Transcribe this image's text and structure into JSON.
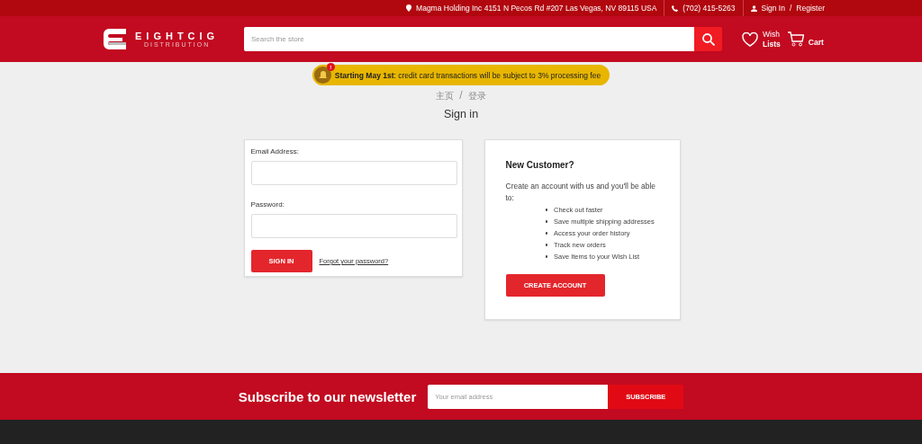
{
  "top_bar": {
    "address": "Magma Holding Inc 4151 N Pecos Rd #207 Las Vegas, NV 89115 USA",
    "phone": "(702) 415-5263",
    "sign_in": "Sign In",
    "separator": "/",
    "register": "Register"
  },
  "header": {
    "logo": {
      "name": "EIGHTCIG",
      "tagline": "DISTRIBUTION"
    },
    "search": {
      "placeholder": "Search the store"
    },
    "wishlist": {
      "line1": "Wish",
      "line2": "Lists"
    },
    "cart": "Cart"
  },
  "notice": {
    "text": "**Starting May 1st**: credit card transactions will be subject to 3% processing fee",
    "badge": "!"
  },
  "breadcrumbs": [
    {
      "label": "主页"
    },
    {
      "label": "登录"
    }
  ],
  "breadcrumb_separator": "/",
  "page_title": "Sign in",
  "login_form": {
    "email_label": "Email Address:",
    "password_label": "Password:",
    "submit": "SIGN IN",
    "forgot": "Forgot your password?"
  },
  "new_customer": {
    "title": "New Customer?",
    "intro": "Create an account with us and you'll be able to:",
    "benefits": [
      "Check out faster",
      "Save multiple shipping addresses",
      "Access your order history",
      "Track new orders",
      "Save Items to your Wish List"
    ],
    "button": "CREATE ACCOUNT"
  },
  "newsletter": {
    "title": "Subscribe to our newsletter",
    "placeholder": "Your email address",
    "button": "SUBSCRIBE"
  }
}
